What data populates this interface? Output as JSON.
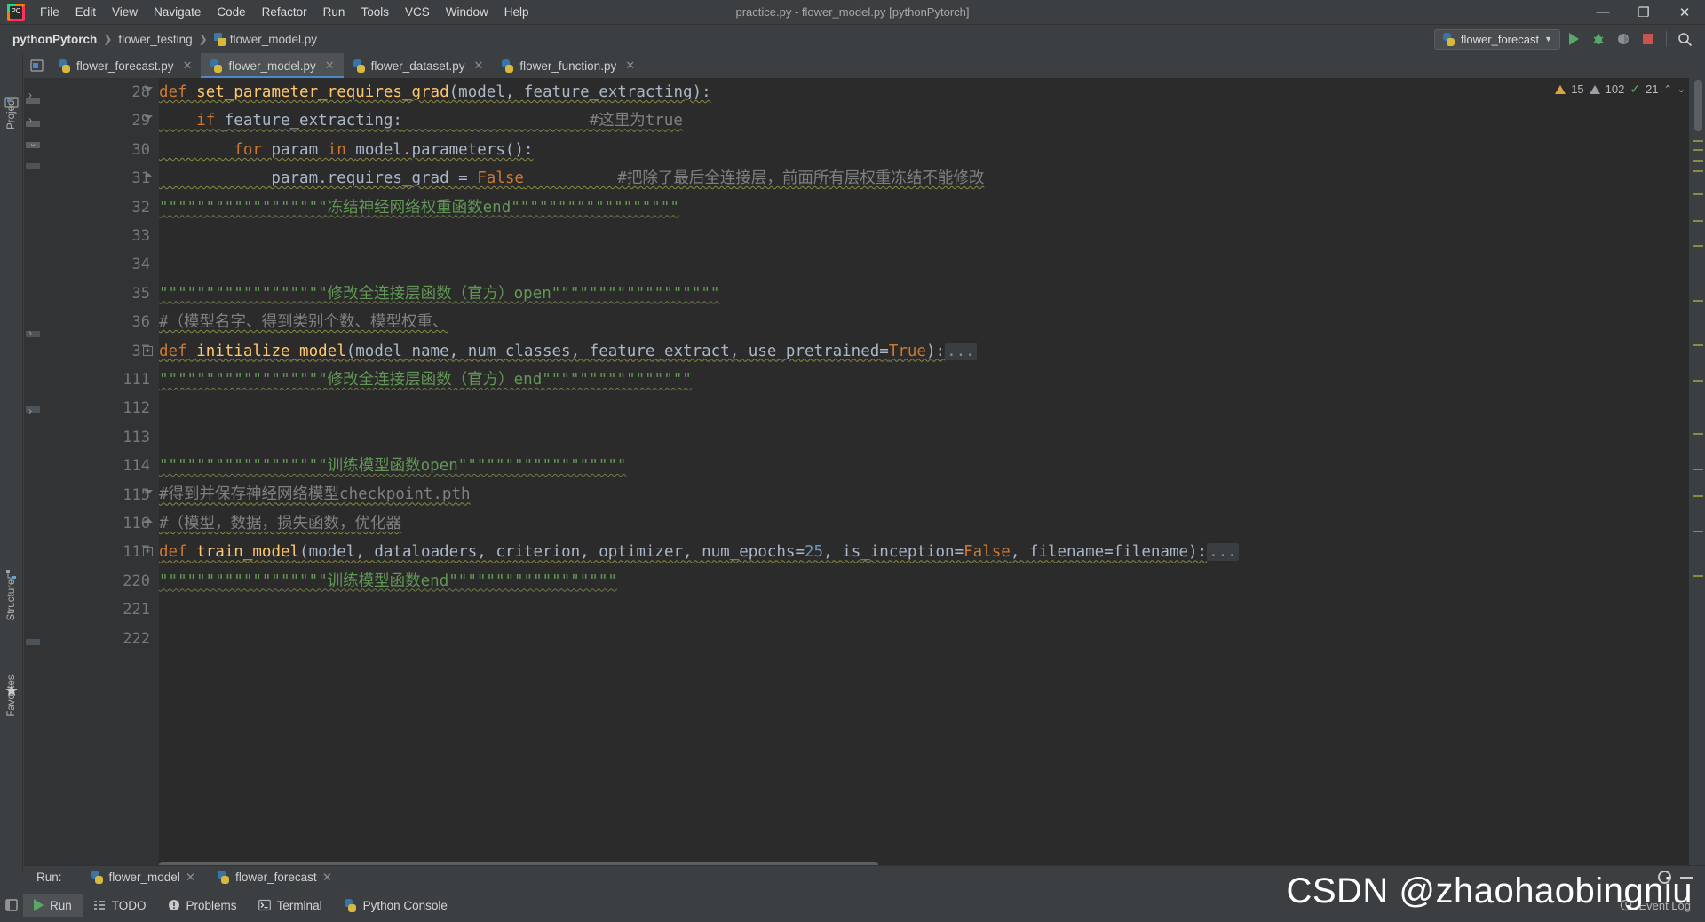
{
  "window": {
    "title": "practice.py - flower_model.py [pythonPytorch]",
    "logo": "pycharm-logo",
    "minimize": "—",
    "maximize": "❐",
    "close": "✕"
  },
  "menu": {
    "items": [
      "File",
      "Edit",
      "View",
      "Navigate",
      "Code",
      "Refactor",
      "Run",
      "Tools",
      "VCS",
      "Window",
      "Help"
    ]
  },
  "breadcrumb": {
    "project": "pythonPytorch",
    "folder": "flower_testing",
    "file": "flower_model.py",
    "separator": "❯"
  },
  "run_config": {
    "name": "flower_forecast",
    "chevron": "▼"
  },
  "toolbar_icons": [
    "run-icon",
    "debug-icon",
    "coverage-icon",
    "stop-icon",
    "search-icon"
  ],
  "left_strip": {
    "project": "Project",
    "structure": "Structure",
    "favorites": "Favorites"
  },
  "editor_tabs": [
    {
      "label": "flower_forecast.py",
      "close": "✕",
      "active": false
    },
    {
      "label": "flower_model.py",
      "close": "✕",
      "active": true
    },
    {
      "label": "flower_dataset.py",
      "close": "✕",
      "active": false
    },
    {
      "label": "flower_function.py",
      "close": "✕",
      "active": false
    }
  ],
  "inspections": {
    "warnings_count": "15",
    "weak_warnings_count": "102",
    "ok_count": "21",
    "up_arrow": "⌃",
    "down_arrow": "⌄"
  },
  "code": {
    "line_numbers": [
      "28",
      "29",
      "30",
      "31",
      "32",
      "33",
      "34",
      "35",
      "36",
      "37",
      "111",
      "112",
      "113",
      "114",
      "115",
      "116",
      "117",
      "220",
      "221",
      "222"
    ],
    "lines": [
      {
        "num": "28",
        "segments": [
          {
            "t": "def ",
            "c": "kw"
          },
          {
            "t": "set_parameter_requires_grad",
            "c": "fn"
          },
          {
            "t": "(model, feature_extracting):",
            "c": "id"
          }
        ]
      },
      {
        "num": "29",
        "segments": [
          {
            "t": "    ",
            "c": "id"
          },
          {
            "t": "if ",
            "c": "kw"
          },
          {
            "t": "feature_extracting:",
            "c": "id"
          },
          {
            "t": "                    ",
            "c": "id"
          },
          {
            "t": "#这里为true",
            "c": "cmt"
          }
        ]
      },
      {
        "num": "30",
        "segments": [
          {
            "t": "        ",
            "c": "id"
          },
          {
            "t": "for ",
            "c": "kw"
          },
          {
            "t": "param ",
            "c": "id"
          },
          {
            "t": "in ",
            "c": "kw"
          },
          {
            "t": "model.parameters():",
            "c": "id"
          }
        ]
      },
      {
        "num": "31",
        "segments": [
          {
            "t": "            param.requires_grad = ",
            "c": "id"
          },
          {
            "t": "False",
            "c": "kw"
          },
          {
            "t": "          ",
            "c": "id"
          },
          {
            "t": "#把除了最后全连接层，前面所有层权重冻结不能修改",
            "c": "cmt"
          }
        ]
      },
      {
        "num": "32",
        "segments": [
          {
            "t": "\"\"\"\"\"\"\"\"\"\"\"\"\"\"\"\"\"\"冻结神经网络权重函数end\"\"\"\"\"\"\"\"\"\"\"\"\"\"\"\"\"\"",
            "c": "doc"
          }
        ]
      },
      {
        "num": "33",
        "segments": [
          {
            "t": "",
            "c": "id"
          }
        ]
      },
      {
        "num": "34",
        "segments": [
          {
            "t": "",
            "c": "id"
          }
        ]
      },
      {
        "num": "35",
        "segments": [
          {
            "t": "\"\"\"\"\"\"\"\"\"\"\"\"\"\"\"\"\"\"修改全连接层函数（官方）open\"\"\"\"\"\"\"\"\"\"\"\"\"\"\"\"\"\"",
            "c": "doc"
          }
        ]
      },
      {
        "num": "36",
        "segments": [
          {
            "t": "#（模型名字、得到类别个数、模型权重、",
            "c": "cmt"
          }
        ]
      },
      {
        "num": "37",
        "segments": [
          {
            "t": "def ",
            "c": "kw"
          },
          {
            "t": "initialize_model",
            "c": "fn"
          },
          {
            "t": "(model_name, num_classes, feature_extract, use_pretrained=",
            "c": "id"
          },
          {
            "t": "True",
            "c": "kw"
          },
          {
            "t": "):",
            "c": "id"
          },
          {
            "t": "...",
            "c": "ellip"
          }
        ]
      },
      {
        "num": "111",
        "segments": [
          {
            "t": "\"\"\"\"\"\"\"\"\"\"\"\"\"\"\"\"\"\"修改全连接层函数（官方）end\"\"\"\"\"\"\"\"\"\"\"\"\"\"\"\"",
            "c": "doc"
          }
        ]
      },
      {
        "num": "112",
        "segments": [
          {
            "t": "",
            "c": "id"
          }
        ]
      },
      {
        "num": "113",
        "segments": [
          {
            "t": "",
            "c": "id"
          }
        ]
      },
      {
        "num": "114",
        "segments": [
          {
            "t": "\"\"\"\"\"\"\"\"\"\"\"\"\"\"\"\"\"\"训练模型函数open\"\"\"\"\"\"\"\"\"\"\"\"\"\"\"\"\"\"",
            "c": "doc"
          }
        ]
      },
      {
        "num": "115",
        "segments": [
          {
            "t": "#得到并保存神经网络模型checkpoint.pth",
            "c": "cmt"
          }
        ]
      },
      {
        "num": "116",
        "segments": [
          {
            "t": "#（模型，数据，损失函数，优化器",
            "c": "cmt"
          }
        ]
      },
      {
        "num": "117",
        "segments": [
          {
            "t": "def ",
            "c": "kw"
          },
          {
            "t": "train_model",
            "c": "fn"
          },
          {
            "t": "(model, dataloaders, criterion, optimizer, num_epochs=",
            "c": "id"
          },
          {
            "t": "25",
            "c": "num-lit"
          },
          {
            "t": ", is_inception=",
            "c": "id"
          },
          {
            "t": "False",
            "c": "kw"
          },
          {
            "t": ", filename=filename):",
            "c": "id"
          },
          {
            "t": "...",
            "c": "ellip"
          }
        ]
      },
      {
        "num": "220",
        "segments": [
          {
            "t": "\"\"\"\"\"\"\"\"\"\"\"\"\"\"\"\"\"\"训练模型函数end\"\"\"\"\"\"\"\"\"\"\"\"\"\"\"\"\"\"",
            "c": "doc"
          }
        ]
      },
      {
        "num": "221",
        "segments": [
          {
            "t": "",
            "c": "id"
          }
        ]
      },
      {
        "num": "222",
        "segments": [
          {
            "t": "",
            "c": "id"
          }
        ]
      }
    ]
  },
  "run_panel": {
    "label": "Run:",
    "tabs": [
      {
        "label": "flower_model",
        "close": "✕",
        "active": false
      },
      {
        "label": "flower_forecast",
        "close": "✕",
        "active": true
      }
    ],
    "settings_icon": "gear-icon",
    "hide_icon": "minimize-icon"
  },
  "status_bar": {
    "buttons": [
      {
        "label": "Run",
        "icon": "run-icon",
        "active": true
      },
      {
        "label": "TODO",
        "icon": "todo-icon",
        "active": false
      },
      {
        "label": "Problems",
        "icon": "problems-icon",
        "active": false
      },
      {
        "label": "Terminal",
        "icon": "terminal-icon",
        "active": false
      },
      {
        "label": "Python Console",
        "icon": "python-icon",
        "active": false
      }
    ],
    "event_log": "Event Log",
    "layout_icon": "layout-icon"
  },
  "watermark": {
    "text": "CSDN @zhaohaobingniu"
  },
  "colors": {
    "editor_bg": "#2b2b2b",
    "chrome_bg": "#3c3f41",
    "gutter_bg": "#313335",
    "keyword": "#cc7832",
    "function": "#ffc66d",
    "identifier": "#a9b7c6",
    "comment": "#808080",
    "docstring": "#629755",
    "number": "#6897bb",
    "accent": "#4a88c7",
    "run_green": "#59a869",
    "stop_red": "#c75450",
    "warn_yellow": "#d9a343"
  }
}
